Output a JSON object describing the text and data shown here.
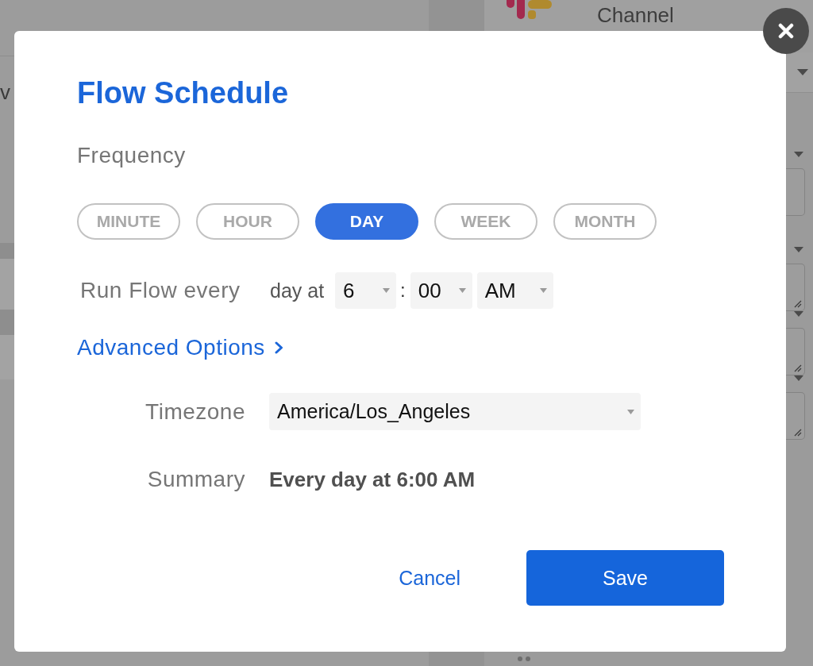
{
  "page": {
    "left_text": "v",
    "panel_title": "Channel",
    "fields": [
      {
        "resizable": false
      },
      {
        "resizable": true
      },
      {
        "resizable": true
      },
      {
        "resizable": true
      }
    ]
  },
  "dialog": {
    "title": "Flow Schedule",
    "frequency": {
      "label": "Frequency",
      "options": [
        {
          "label": "MINUTE",
          "selected": false
        },
        {
          "label": "HOUR",
          "selected": false
        },
        {
          "label": "DAY",
          "selected": true
        },
        {
          "label": "WEEK",
          "selected": false
        },
        {
          "label": "MONTH",
          "selected": false
        }
      ]
    },
    "run": {
      "label": "Run Flow every",
      "prefix": "day at",
      "hour": "6",
      "separator": ":",
      "minute": "00",
      "period": "AM"
    },
    "advanced_options": {
      "label": "Advanced Options"
    },
    "timezone": {
      "label": "Timezone",
      "value": "America/Los_Angeles"
    },
    "summary": {
      "label": "Summary",
      "value": "Every day at 6:00 AM"
    },
    "buttons": [
      {
        "label": "Cancel",
        "kind": "link"
      },
      {
        "label": "Save",
        "kind": "primary"
      }
    ]
  }
}
